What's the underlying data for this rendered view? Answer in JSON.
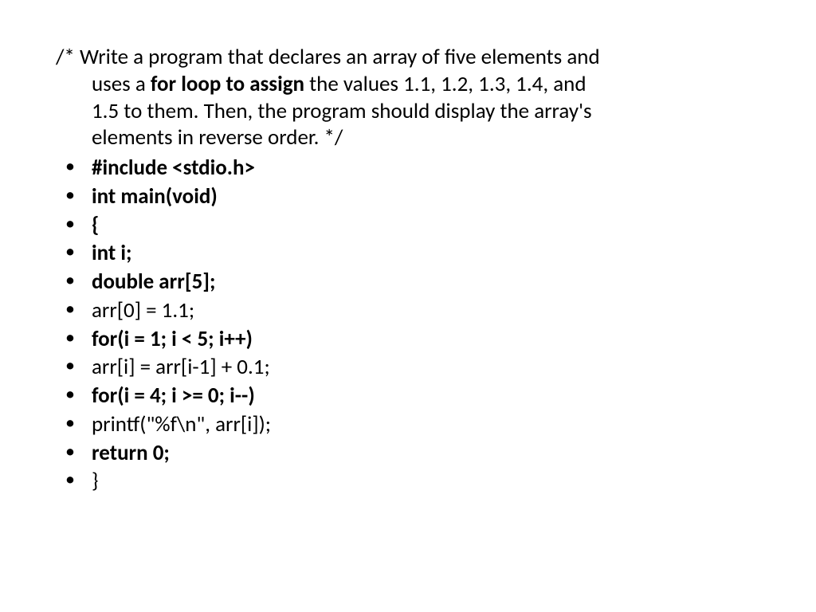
{
  "comment": {
    "prefix": "/* Write a program that declares an array of five elements and",
    "line2": "uses a ",
    "bold_phrase": "for loop to assign",
    "line2_cont": " the values 1.1, 1.2, 1.3, 1.4, and",
    "line3": "1.5 to them. Then, the program should display the array's",
    "line4": "elements in reverse order. */"
  },
  "code": {
    "include": "#include <stdio.h>",
    "main_decl": "int main(void)",
    "open_brace": "{",
    "int_i": "int i;",
    "double_arr": "double arr[5];",
    "arr_init": "arr[0] = 1.1;",
    "for1": "for(i = 1; i < 5; i++)",
    "arr_assign": "arr[i] = arr[i-1] + 0.1;",
    "for2": "for(i = 4; i >= 0; i--)",
    "printf": "printf(\"%f\\n\", arr[i]);",
    "return": "return 0;",
    "close_brace": "}"
  }
}
